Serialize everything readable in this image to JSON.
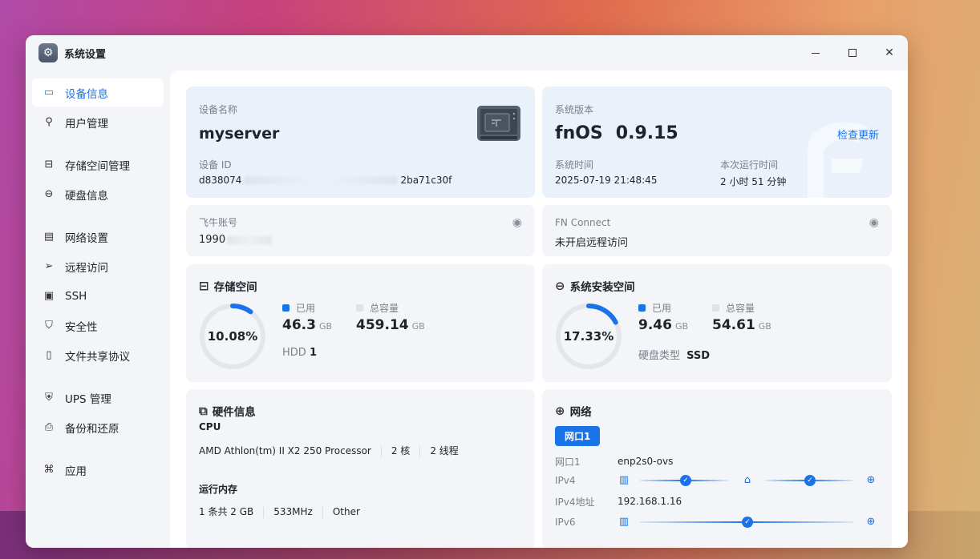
{
  "window": {
    "title": "系统设置"
  },
  "sidebar": {
    "items": [
      {
        "label": "设备信息",
        "icon": "device-icon",
        "active": true
      },
      {
        "label": "用户管理",
        "icon": "user-icon"
      },
      {
        "label": "存储空间管理",
        "icon": "storage-icon"
      },
      {
        "label": "硬盘信息",
        "icon": "disk-icon"
      },
      {
        "label": "网络设置",
        "icon": "network-icon"
      },
      {
        "label": "远程访问",
        "icon": "send-icon"
      },
      {
        "label": "SSH",
        "icon": "terminal-icon"
      },
      {
        "label": "安全性",
        "icon": "shield-icon"
      },
      {
        "label": "文件共享协议",
        "icon": "file-icon"
      },
      {
        "label": "UPS 管理",
        "icon": "ups-icon"
      },
      {
        "label": "备份和还原",
        "icon": "backup-icon"
      },
      {
        "label": "应用",
        "icon": "apps-icon"
      }
    ]
  },
  "device": {
    "name_label": "设备名称",
    "name": "myserver",
    "id_label": "设备 ID",
    "id_start": "d838074",
    "id_end": "2ba71c30f"
  },
  "system": {
    "version_label": "系统版本",
    "version_name": "fnOS",
    "version": "0.9.15",
    "check_update": "检查更新",
    "time_label": "系统时间",
    "time": "2025-07-19 21:48:45",
    "uptime_label": "本次运行时间",
    "uptime": "2 小时 51 分钟"
  },
  "account": {
    "label": "飞牛账号",
    "value": "1990"
  },
  "fnconnect": {
    "label": "FN Connect",
    "value": "未开启远程访问"
  },
  "storage": {
    "title": "存储空间",
    "percent_text": "10.08%",
    "percent": 10.08,
    "used_label": "已用",
    "used": "46.3",
    "used_unit": "GB",
    "total_label": "总容量",
    "total": "459.14",
    "total_unit": "GB",
    "hdd_label": "HDD",
    "hdd_count": "1"
  },
  "sys_storage": {
    "title": "系统安装空间",
    "percent_text": "17.33%",
    "percent": 17.33,
    "used_label": "已用",
    "used": "9.46",
    "used_unit": "GB",
    "total_label": "总容量",
    "total": "54.61",
    "total_unit": "GB",
    "disk_type_label": "硬盘类型",
    "disk_type": "SSD"
  },
  "hardware": {
    "title": "硬件信息",
    "cpu_label": "CPU",
    "cpu_model": "AMD Athlon(tm) II X2 250 Processor",
    "cpu_cores": "2 核",
    "cpu_threads": "2 线程",
    "mem_label": "运行内存",
    "mem_count": "1 条共 2 GB",
    "mem_speed": "533MHz",
    "mem_type": "Other"
  },
  "network": {
    "title": "网络",
    "tab": "网口1",
    "port_label": "网口1",
    "port_value": "enp2s0-ovs",
    "ipv4_label": "IPv4",
    "ipv4_addr_label": "IPv4地址",
    "ipv4_addr": "192.168.1.16",
    "ipv6_label": "IPv6"
  },
  "colors": {
    "accent": "#1a73e8",
    "ring_track": "#e3e6ea"
  }
}
